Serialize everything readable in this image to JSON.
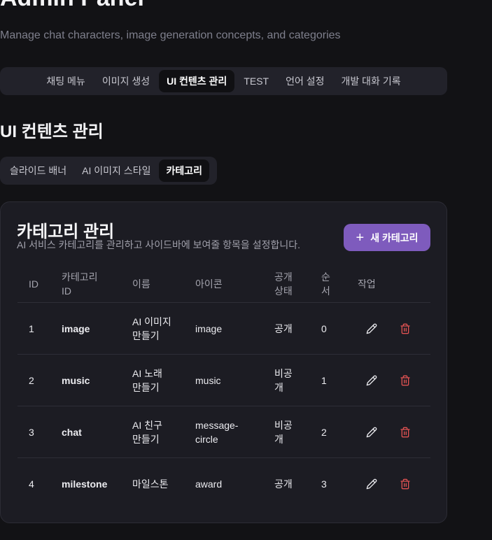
{
  "app": {
    "title": "Admin Panel",
    "subtitle": "Manage chat characters, image generation concepts, and categories"
  },
  "main_tabs": [
    {
      "label": "채팅 메뉴"
    },
    {
      "label": "이미지 생성"
    },
    {
      "label": "UI 컨텐츠 관리",
      "active": true
    },
    {
      "label": "TEST"
    },
    {
      "label": "언어 설정"
    },
    {
      "label": "개발 대화 기록"
    }
  ],
  "section": {
    "title": "UI 컨텐츠 관리"
  },
  "sub_tabs": [
    {
      "label": "슬라이드 배너"
    },
    {
      "label": "AI 이미지 스타일"
    },
    {
      "label": "카테고리",
      "active": true
    }
  ],
  "card": {
    "title": "카테고리 관리",
    "description": "AI 서비스 카테고리를 관리하고 사이드바에 보여줄 항목을 설정합니다.",
    "add_button": "새 카테고리"
  },
  "table": {
    "headers": {
      "id": "ID",
      "category_id_1": "카테고리",
      "category_id_2": "ID",
      "name": "이름",
      "icon": "아이콘",
      "status_1": "공개",
      "status_2": "상태",
      "order_1": "순",
      "order_2": "서",
      "actions": "작업"
    },
    "rows": [
      {
        "id": "1",
        "category_id": "image",
        "name_1": "AI 이미지",
        "name_2": "만들기",
        "icon_1": "image",
        "icon_2": "",
        "status_1": "공개",
        "status_2": "",
        "order": "0"
      },
      {
        "id": "2",
        "category_id": "music",
        "name_1": "AI 노래",
        "name_2": "만들기",
        "icon_1": "music",
        "icon_2": "",
        "status_1": "비공",
        "status_2": "개",
        "order": "1"
      },
      {
        "id": "3",
        "category_id": "chat",
        "name_1": "AI 친구",
        "name_2": "만들기",
        "icon_1": "message-",
        "icon_2": "circle",
        "status_1": "비공",
        "status_2": "개",
        "order": "2"
      },
      {
        "id": "4",
        "category_id": "milestone",
        "name_1": "마일스톤",
        "name_2": "",
        "icon_1": "award",
        "icon_2": "",
        "status_1": "공개",
        "status_2": "",
        "order": "3"
      }
    ]
  },
  "icons": {
    "edit": "pencil-icon",
    "delete": "trash-icon",
    "add": "plus-icon"
  },
  "colors": {
    "background": "#121215",
    "card": "#1c1c23",
    "accent": "#7e5bbd",
    "delete": "#e05252"
  }
}
